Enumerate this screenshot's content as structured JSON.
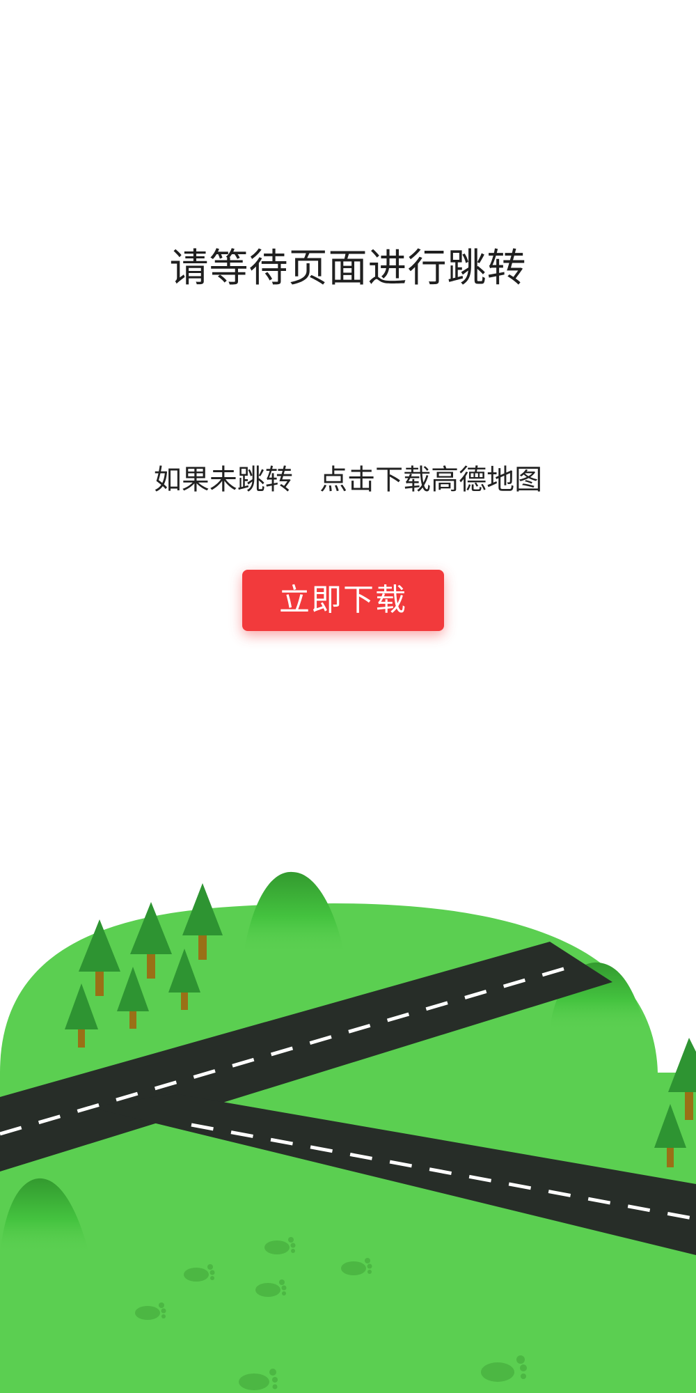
{
  "page": {
    "title": "请等待页面进行跳转",
    "hint": "如果未跳转   点击下载高德地图",
    "download_button_label": "立即下载"
  },
  "colors": {
    "button": "#f23a3c",
    "grass": "#5bcf51",
    "grass_dark": "#3aa737",
    "road": "#272d28",
    "trunk": "#9a7016",
    "tree": "#2e9432"
  },
  "illustration": {
    "icons": [
      "hill-icon",
      "tree-icon",
      "road-icon",
      "footprint-icon"
    ]
  }
}
